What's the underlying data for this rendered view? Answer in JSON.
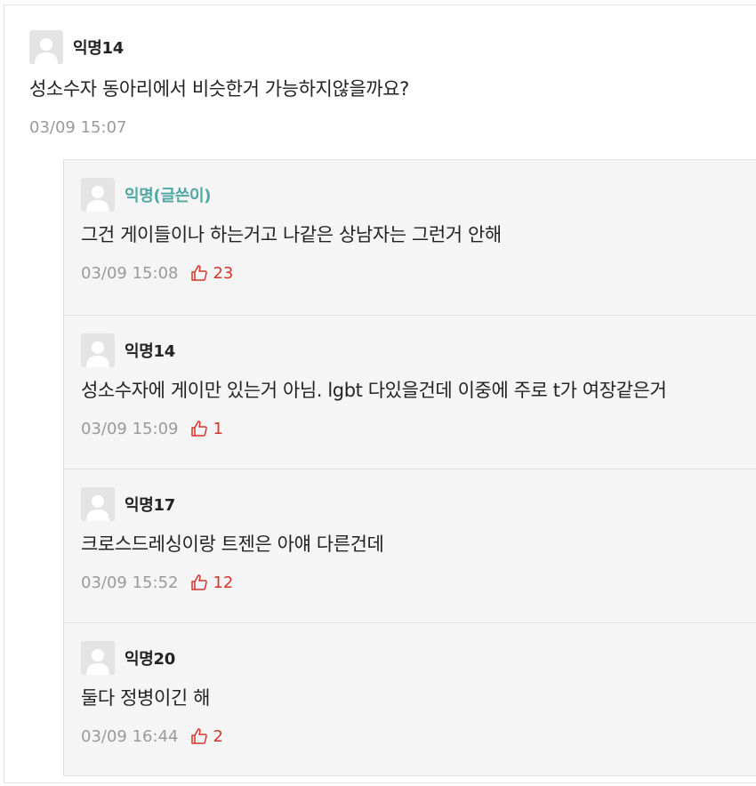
{
  "main_comment": {
    "author": "익명14",
    "text": "성소수자 동아리에서 비슷한거 가능하지않을까요?",
    "timestamp": "03/09 15:07"
  },
  "replies": [
    {
      "author": "익명(글쓴이)",
      "is_op": true,
      "text": "그건 게이들이나 하는거고 나같은 상남자는 그런거 안해",
      "timestamp": "03/09 15:08",
      "likes": "23"
    },
    {
      "author": "익명14",
      "is_op": false,
      "text": "성소수자에 게이만 있는거 아님. lgbt 다있을건데 이중에 주로 t가 여장같은거",
      "timestamp": "03/09 15:09",
      "likes": "1"
    },
    {
      "author": "익명17",
      "is_op": false,
      "text": "크로스드레싱이랑 트젠은 아얘 다른건데",
      "timestamp": "03/09 15:52",
      "likes": "12"
    },
    {
      "author": "익명20",
      "is_op": false,
      "text": "둘다 정병이긴 해",
      "timestamp": "03/09 16:44",
      "likes": "2"
    }
  ],
  "icons": {
    "avatar": "default-avatar-icon",
    "like": "thumbs-up-icon"
  },
  "colors": {
    "op_author": "#4fa8a3",
    "like": "#d4352b",
    "meta": "#9a9a9a",
    "reply_bg": "#f5f5f5"
  }
}
